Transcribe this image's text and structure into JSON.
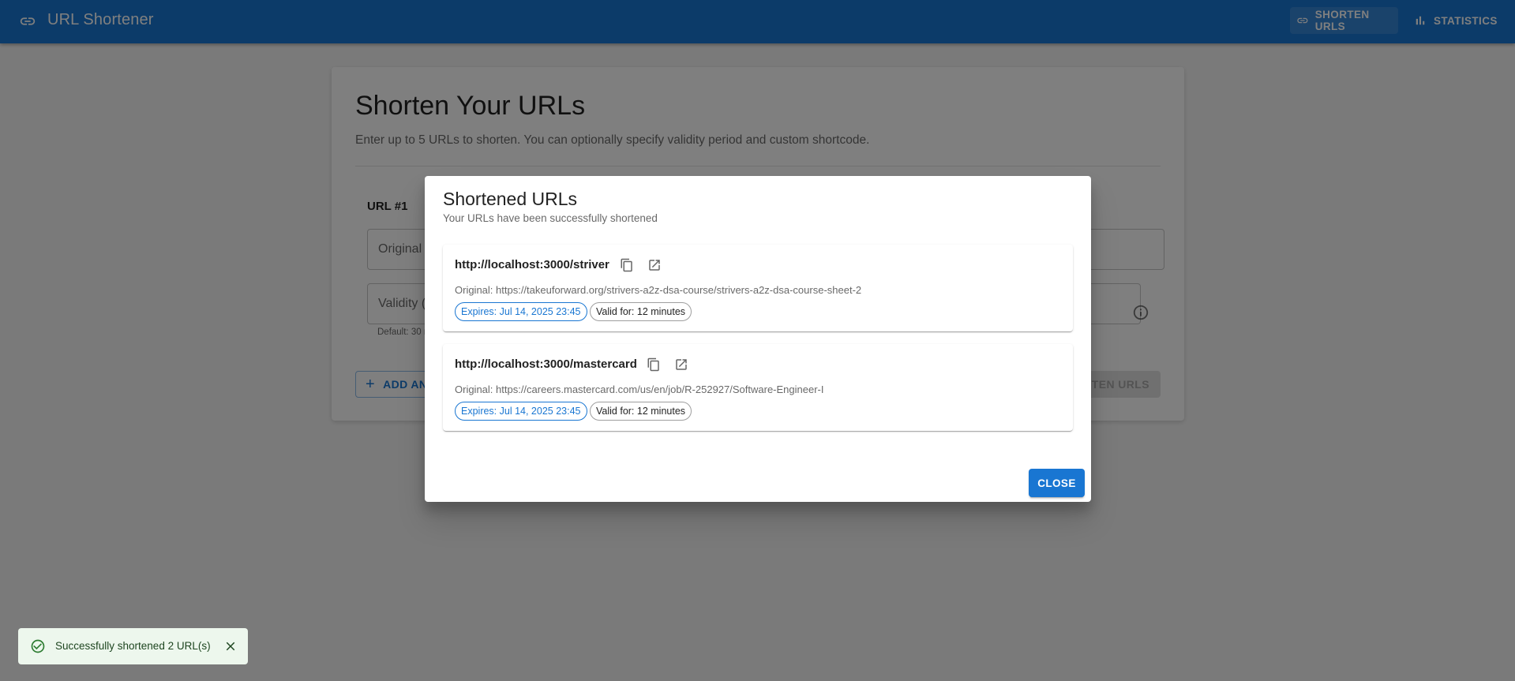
{
  "appbar": {
    "title": "URL Shortener",
    "nav": [
      {
        "label": "SHORTEN URLS",
        "icon": "link-icon",
        "active": true
      },
      {
        "label": "STATISTICS",
        "icon": "bar-chart-icon",
        "active": false
      }
    ]
  },
  "form": {
    "title": "Shorten Your URLs",
    "subtitle": "Enter up to 5 URLs to shorten. You can optionally specify validity period and custom shortcode.",
    "url_label": "URL #1",
    "original_placeholder": "Original URL",
    "validity_placeholder": "Validity (minutes)",
    "helper": "Default: 30 minutes",
    "add_button": "ADD ANOTHER URL",
    "submit_button": "SHORTEN URLS"
  },
  "dialog": {
    "title": "Shortened URLs",
    "subtitle": "Your URLs have been successfully shortened",
    "results": [
      {
        "short_url": "http://localhost:3000/striver",
        "original": "Original: https://takeuforward.org/strivers-a2z-dsa-course/strivers-a2z-dsa-course-sheet-2",
        "expires": "Expires: Jul 14, 2025 23:45",
        "valid_for": "Valid for: 12 minutes"
      },
      {
        "short_url": "http://localhost:3000/mastercard",
        "original": "Original: https://careers.mastercard.com/us/en/job/R-252927/Software-Engineer-I",
        "expires": "Expires: Jul 14, 2025 23:45",
        "valid_for": "Valid for: 12 minutes"
      }
    ],
    "close_button": "CLOSE"
  },
  "snackbar": {
    "message": "Successfully shortened 2 URL(s)"
  },
  "colors": {
    "primary": "#1976d2",
    "success_bg": "#edf7ed",
    "success_icon": "#2e7d32"
  }
}
